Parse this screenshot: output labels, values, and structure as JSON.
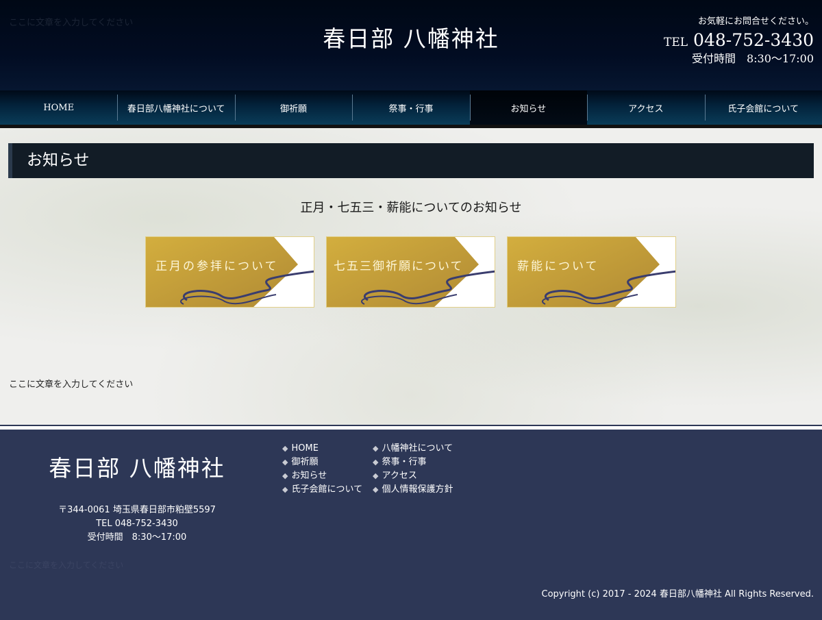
{
  "header": {
    "tagline": "ここに文章を入力してください",
    "site_title": "春日部 八幡神社",
    "contact_lead": "お気軽にお問合せください。",
    "tel_prefix": "TEL",
    "tel_number": "048-752-3430",
    "hours": "受付時間　8:30〜17:00"
  },
  "nav": {
    "items": [
      {
        "label": "HOME"
      },
      {
        "label": "春日部八幡神社について"
      },
      {
        "label": "御祈願"
      },
      {
        "label": "祭事・行事"
      },
      {
        "label": "お知らせ"
      },
      {
        "label": "アクセス"
      },
      {
        "label": "氏子会館について"
      }
    ],
    "active_index": 4
  },
  "main": {
    "heading": "お知らせ",
    "section_title": "正月・七五三・薪能についてのお知らせ",
    "banners": [
      {
        "label": "正月の参拝について"
      },
      {
        "label": "七五三御祈願について"
      },
      {
        "label": "薪能について"
      }
    ],
    "note": "ここに文章を入力してください"
  },
  "footer": {
    "site_title": "春日部 八幡神社",
    "address": "〒344-0061 埼玉県春日部市粕壁5597",
    "tel": "TEL 048-752-3430",
    "hours": "受付時間　8:30〜17:00",
    "faint_text": "ここに文章を入力してください",
    "links": [
      {
        "label": "HOME"
      },
      {
        "label": "八幡神社について"
      },
      {
        "label": "御祈願"
      },
      {
        "label": "祭事・行事"
      },
      {
        "label": "お知らせ"
      },
      {
        "label": "アクセス"
      },
      {
        "label": "氏子会館について"
      },
      {
        "label": "個人情報保護方針"
      }
    ],
    "link_bullet": "◆",
    "copyright": "Copyright (c) 2017 - 2024 春日部八幡神社 All Rights Reserved."
  },
  "colors": {
    "header_bg": "#000815",
    "heading_bg": "#121c26",
    "footer_bg": "#2d3756",
    "banner_gold": "#c9a23a",
    "banner_wave": "#3a3d6e"
  }
}
